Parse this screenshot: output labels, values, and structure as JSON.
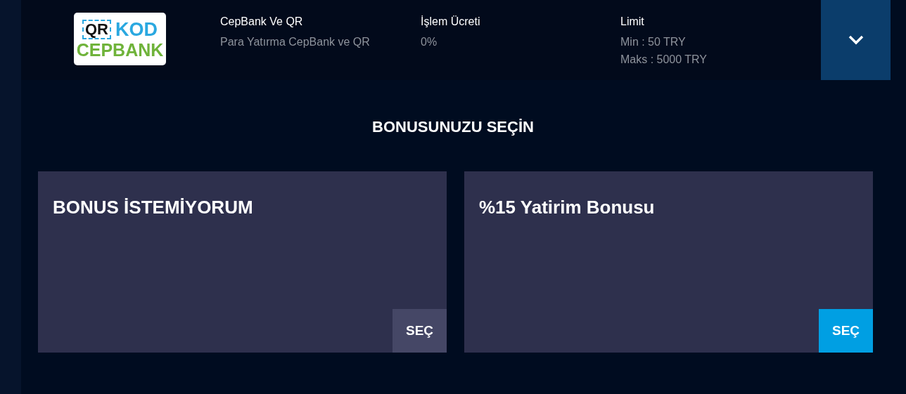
{
  "method": {
    "logo": {
      "top_left": "QR",
      "top_right": "KOD",
      "bottom": "CEPBANK"
    },
    "name": "CepBank Ve QR",
    "description": "Para Yatırma CepBank ve QR",
    "fee_label": "İşlem Ücreti",
    "fee": "0%",
    "limit_label": "Limit",
    "limit_min": "Min : 50 TRY",
    "limit_max": "Maks : 5000 TRY",
    "expanded": false
  },
  "heading": "BONUSUNUZU SEÇİN",
  "bonuses": [
    {
      "title": "BONUS İSTEMİYORUM",
      "button": "SEÇ",
      "selected": false
    },
    {
      "title": "%15 Yatirim Bonusu",
      "button": "SEÇ",
      "selected": true
    }
  ]
}
